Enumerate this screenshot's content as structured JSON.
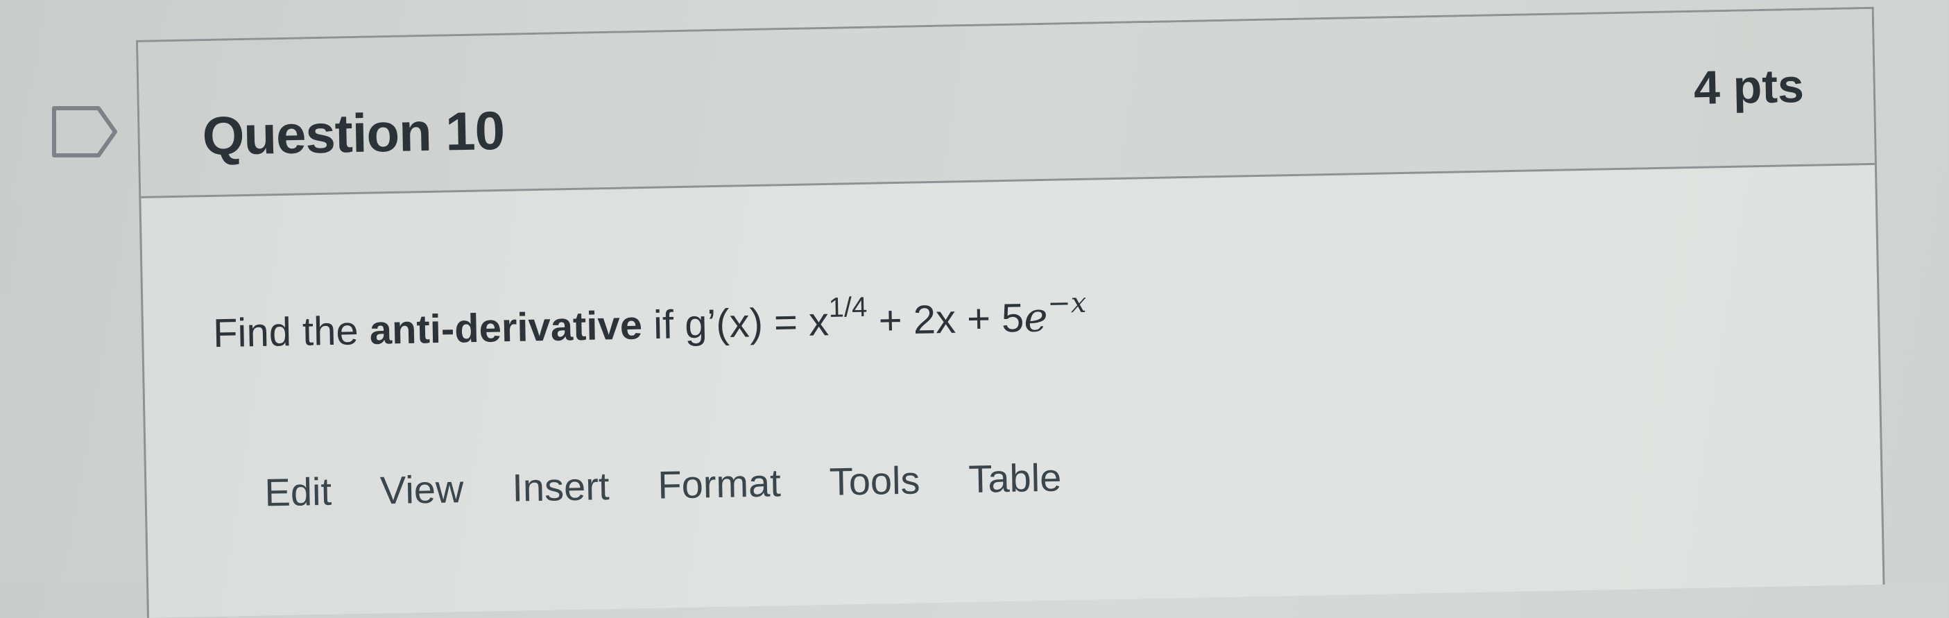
{
  "question": {
    "title": "Question 10",
    "points": "4 pts",
    "text_prefix": "Find the ",
    "text_bold": "anti-derivative",
    "text_mid": " if g’(x) = x",
    "exponent": "1/4",
    "text_after_exp": " + 2x + 5",
    "e_symbol": "e",
    "e_exponent": "−x"
  },
  "editor": {
    "menu": [
      "Edit",
      "View",
      "Insert",
      "Format",
      "Tools",
      "Table"
    ]
  },
  "icons": {
    "flag": "flag-outline-icon"
  }
}
